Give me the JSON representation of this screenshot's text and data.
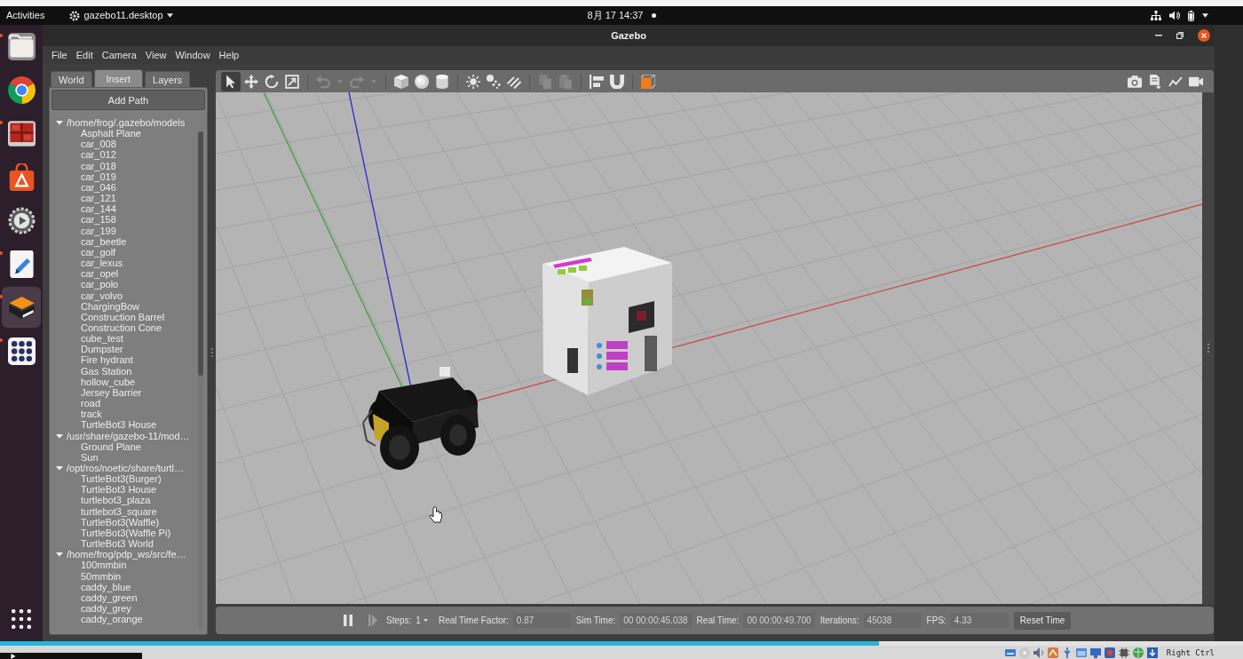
{
  "top_bar": {
    "activities": "Activities",
    "app_menu": "gazebo11.desktop",
    "clock": "8月 17 14:37",
    "notification": true
  },
  "dock": [
    {
      "kind": "files",
      "running": true,
      "selected": false
    },
    {
      "kind": "browser",
      "running": false,
      "selected": false
    },
    {
      "kind": "remote",
      "running": true,
      "selected": false
    },
    {
      "kind": "store",
      "running": false,
      "selected": false
    },
    {
      "kind": "settings",
      "running": false,
      "selected": false
    },
    {
      "kind": "editor",
      "running": true,
      "selected": false
    },
    {
      "kind": "gazebo",
      "running": true,
      "selected": true
    },
    {
      "kind": "grid",
      "running": true,
      "selected": false
    },
    {
      "kind": "show-apps",
      "running": false,
      "selected": false
    }
  ],
  "window": {
    "title": "Gazebo"
  },
  "menu": [
    "File",
    "Edit",
    "Camera",
    "View",
    "Window",
    "Help"
  ],
  "left_panel": {
    "tabs": [
      {
        "label": "World",
        "selected": false
      },
      {
        "label": "Insert",
        "selected": true
      },
      {
        "label": "Layers",
        "selected": false
      }
    ],
    "add_path_button": "Add Path",
    "tree": [
      {
        "label": "/home/frog/.gazebo/models",
        "expanded": true,
        "children": [
          {
            "label": "Asphalt Plane"
          },
          {
            "label": "car_008"
          },
          {
            "label": "car_012"
          },
          {
            "label": "car_018"
          },
          {
            "label": "car_019"
          },
          {
            "label": "car_046"
          },
          {
            "label": "car_121"
          },
          {
            "label": "car_144"
          },
          {
            "label": "car_158"
          },
          {
            "label": "car_199"
          },
          {
            "label": "car_beetle"
          },
          {
            "label": "car_golf"
          },
          {
            "label": "car_lexus"
          },
          {
            "label": "car_opel"
          },
          {
            "label": "car_polo"
          },
          {
            "label": "car_volvo"
          },
          {
            "label": "ChargingBow"
          },
          {
            "label": "Construction Barrel"
          },
          {
            "label": "Construction Cone"
          },
          {
            "label": "cube_test"
          },
          {
            "label": "Dumpster"
          },
          {
            "label": "Fire hydrant"
          },
          {
            "label": "Gas Station"
          },
          {
            "label": "hollow_cube"
          },
          {
            "label": "Jersey Barrier"
          },
          {
            "label": "road"
          },
          {
            "label": "track"
          },
          {
            "label": "TurtleBot3 House"
          }
        ]
      },
      {
        "label": "/usr/share/gazebo-11/mod…",
        "expanded": true,
        "children": [
          {
            "label": "Ground Plane"
          },
          {
            "label": "Sun"
          }
        ]
      },
      {
        "label": "/opt/ros/noetic/share/turtl…",
        "expanded": true,
        "children": [
          {
            "label": "TurtleBot3(Burger)"
          },
          {
            "label": "TurtleBot3 House"
          },
          {
            "label": "turtlebot3_plaza"
          },
          {
            "label": "turtlebot3_square"
          },
          {
            "label": "TurtleBot3(Waffle)"
          },
          {
            "label": "TurtleBot3(Waffle Pi)"
          },
          {
            "label": "TurtleBot3 World"
          }
        ]
      },
      {
        "label": "/home/frog/pdp_ws/src/fe…",
        "expanded": true,
        "children": [
          {
            "label": "100mmbin"
          },
          {
            "label": "50mmbin"
          },
          {
            "label": "caddy_blue"
          },
          {
            "label": "caddy_green"
          },
          {
            "label": "caddy_grey"
          },
          {
            "label": "caddy_orange"
          }
        ]
      }
    ]
  },
  "toolbar": {
    "modes": [
      {
        "kind": "select",
        "selected": true
      },
      {
        "kind": "translate",
        "selected": false
      },
      {
        "kind": "rotate",
        "selected": false
      },
      {
        "kind": "scale",
        "selected": false
      }
    ],
    "groups": [
      {
        "items": [
          {
            "kind": "undo",
            "disabled": true
          },
          {
            "kind": "undo-history",
            "disabled": true
          },
          {
            "kind": "redo",
            "disabled": true
          },
          {
            "kind": "redo-history",
            "disabled": true
          }
        ]
      },
      {
        "items": [
          {
            "kind": "box",
            "disabled": false
          },
          {
            "kind": "sphere",
            "disabled": false
          },
          {
            "kind": "cylinder",
            "disabled": false
          }
        ]
      },
      {
        "items": [
          {
            "kind": "point-light",
            "disabled": false
          },
          {
            "kind": "spot-light",
            "disabled": false
          },
          {
            "kind": "directional-light",
            "disabled": false
          }
        ]
      },
      {
        "items": [
          {
            "kind": "copy",
            "disabled": true
          },
          {
            "kind": "paste",
            "disabled": true
          }
        ]
      },
      {
        "items": [
          {
            "kind": "align",
            "disabled": false
          },
          {
            "kind": "snap",
            "disabled": false
          }
        ]
      },
      {
        "items": [
          {
            "kind": "view-angle",
            "disabled": false
          }
        ]
      }
    ],
    "right": [
      {
        "kind": "screenshot"
      },
      {
        "kind": "log"
      },
      {
        "kind": "plot"
      },
      {
        "kind": "record"
      }
    ]
  },
  "bottom_bar": {
    "running": true,
    "step": {
      "disabled": true
    },
    "steps_label": "Steps:",
    "steps_value": "1",
    "fields": [
      {
        "label": "Real Time Factor:",
        "value": "0.87"
      },
      {
        "label": "Sim Time:",
        "value": "00 00:00:45.038"
      },
      {
        "label": "Real Time:",
        "value": "00 00:00:49.700"
      },
      {
        "label": "Iterations:",
        "value": "45038"
      },
      {
        "label": "FPS:",
        "value": "4.33"
      }
    ],
    "reset_button": "Reset Time"
  },
  "status_bar": {
    "video_progress": {
      "level": 0.707
    },
    "host_key": "Right Ctrl"
  }
}
